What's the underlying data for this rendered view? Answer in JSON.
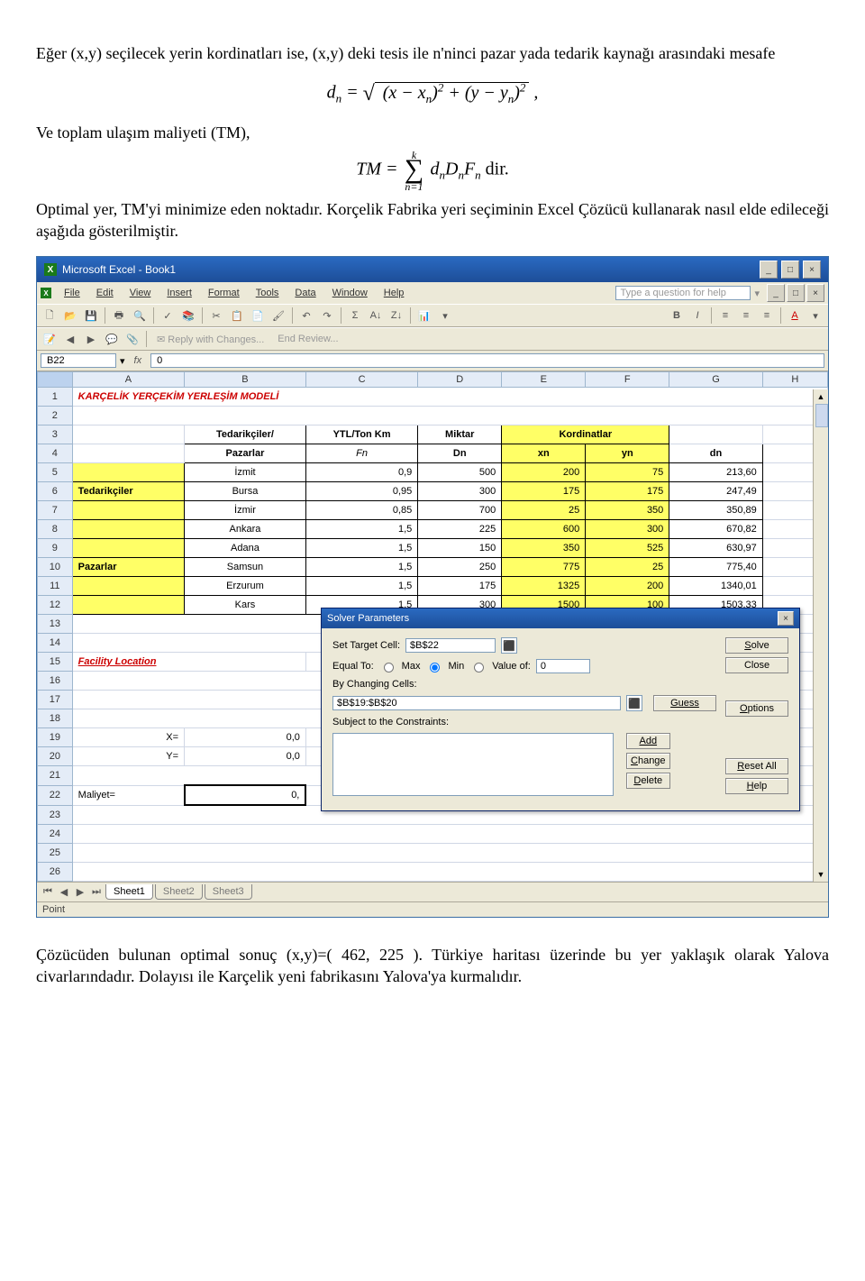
{
  "body": {
    "para1": "Eğer (x,y) seçilecek yerin kordinatları ise, (x,y) deki tesis ile n'ninci pazar yada tedarik kaynağı arasındaki mesafe",
    "para_tm": "Ve toplam ulaşım maliyeti (TM),",
    "para_opt": "Optimal yer, TM'yi minimize eden noktadır. Korçelik Fabrika yeri seçiminin Excel Çözücü kullanarak nasıl elde edileceği aşağıda gösterilmiştir.",
    "para_result": "Çözücüden bulunan optimal sonuç (x,y)=( 462, 225 ). Türkiye haritası üzerinde bu yer yaklaşık olarak Yalova civarlarındadır. Dolayısı ile Karçelik yeni fabrikasını Yalova'ya kurmalıdır."
  },
  "formula_d": {
    "lhs": "d",
    "lhsSub": "n",
    "eq": " = ",
    "inside1": "(x − x",
    "inside1sub": "n",
    "inside1end": ")",
    "sup2a": "2",
    "plus": " + (y − y",
    "inside2sub": "n",
    "inside2end": ")",
    "sup2b": "2",
    "comma": " ,"
  },
  "formula_tm": {
    "lhs": "TM = ",
    "sum_top": "k",
    "sum_bot": "n=1",
    "rhs": " d",
    "rhs_n1": "n",
    "rhs_D": "D",
    "rhs_n2": "n",
    "rhs_F": "F",
    "rhs_n3": "n",
    "dir": "    dir."
  },
  "excel": {
    "title": "Microsoft Excel - Book1",
    "menus": [
      "File",
      "Edit",
      "View",
      "Insert",
      "Format",
      "Tools",
      "Data",
      "Window",
      "Help"
    ],
    "helpPlaceholder": "Type a question for help",
    "reviewBar": {
      "reply": "Reply with Changes...",
      "end": "End Review..."
    },
    "nameBox": "B22",
    "fx": "fx",
    "cellValue": "0",
    "columns": [
      "",
      "A",
      "B",
      "C",
      "D",
      "E",
      "F",
      "G",
      "H"
    ],
    "rows": [
      "1",
      "2",
      "3",
      "4",
      "5",
      "6",
      "7",
      "8",
      "9",
      "10",
      "11",
      "12",
      "13",
      "14",
      "15",
      "16",
      "17",
      "18",
      "19",
      "20",
      "21",
      "22",
      "23",
      "24",
      "25",
      "26"
    ],
    "r1_title": "KARÇELİK YERÇEKİM YERLEŞİM MODELİ",
    "hdr_ted": "Tedarikçiler/",
    "hdr_paz": "Pazarlar",
    "hdr_ytl_top": "YTL/Ton Km",
    "hdr_ytl_sub": "Fn",
    "hdr_miktar": "Miktar",
    "hdr_dn": "Dn",
    "hdr_kord": "Kordinatlar",
    "hdr_xn": "xn",
    "hdr_yn": "yn",
    "hdr_dncol": "dn",
    "sideTed": "Tedarikçiler",
    "sidePaz": "Pazarlar",
    "rowsData": [
      {
        "name": "İzmit",
        "f": "0,9",
        "d": "500",
        "x": "200",
        "y": "75",
        "dn": "213,60"
      },
      {
        "name": "Bursa",
        "f": "0,95",
        "d": "300",
        "x": "175",
        "y": "175",
        "dn": "247,49"
      },
      {
        "name": "İzmir",
        "f": "0,85",
        "d": "700",
        "x": "25",
        "y": "350",
        "dn": "350,89"
      },
      {
        "name": "Ankara",
        "f": "1,5",
        "d": "225",
        "x": "600",
        "y": "300",
        "dn": "670,82"
      },
      {
        "name": "Adana",
        "f": "1,5",
        "d": "150",
        "x": "350",
        "y": "525",
        "dn": "630,97"
      },
      {
        "name": "Samsun",
        "f": "1,5",
        "d": "250",
        "x": "775",
        "y": "25",
        "dn": "775,40"
      },
      {
        "name": "Erzurum",
        "f": "1,5",
        "d": "175",
        "x": "1325",
        "y": "200",
        "dn": "1340,01"
      },
      {
        "name": "Kars",
        "f": "1,5",
        "d": "300",
        "x": "1500",
        "y": "100",
        "dn": "1503,33"
      }
    ],
    "facLoc": "Facility Location",
    "Xlabel": "X=",
    "Xval": "0,0",
    "Ylabel": "Y=",
    "Yval": "0,0",
    "Mlabel": "Maliyet=",
    "Mval": "0,",
    "tabs": [
      "Sheet1",
      "Sheet2",
      "Sheet3"
    ],
    "status": "Point"
  },
  "solver": {
    "title": "Solver Parameters",
    "setTarget": "Set Target Cell:",
    "targetVal": "$B$22",
    "equalTo": "Equal To:",
    "max": "Max",
    "min": "Min",
    "valueOf": "Value of:",
    "valueOfVal": "0",
    "byChanging": "By Changing Cells:",
    "changingVal": "$B$19:$B$20",
    "subject": "Subject to the Constraints:",
    "guess": "Guess",
    "add": "Add",
    "change": "Change",
    "delete": "Delete",
    "solve": "Solve",
    "close": "Close",
    "options": "Options",
    "reset": "Reset All",
    "help": "Help"
  }
}
